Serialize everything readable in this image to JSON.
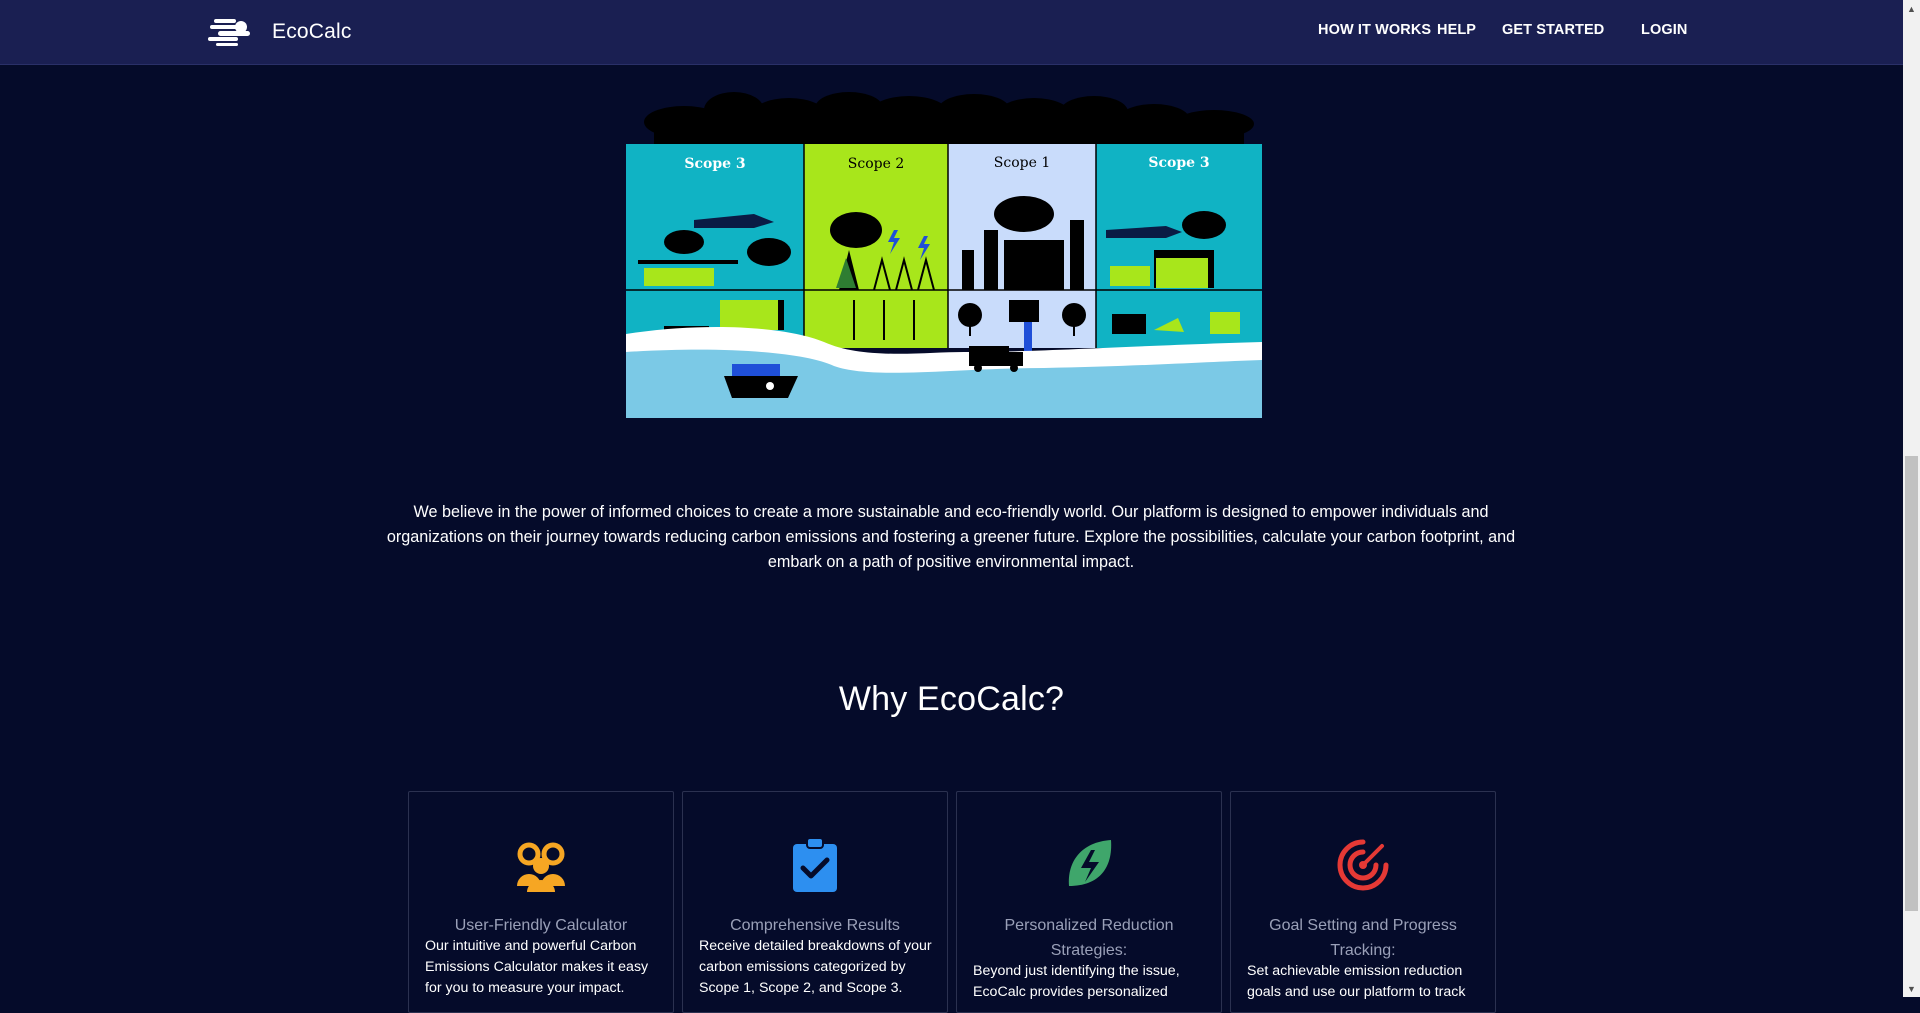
{
  "nav": {
    "brand": "EcoCalc",
    "links": [
      "HOW IT WORKS",
      "HELP",
      "GET STARTED",
      "LOGIN"
    ]
  },
  "hero": {
    "scopes": [
      "Scope 3",
      "Scope 2",
      "Scope 1",
      "Scope 3"
    ]
  },
  "intro": "We believe in the power of informed choices to create a more sustainable and eco-friendly world. Our platform is designed to empower individuals and organizations on their journey towards reducing carbon emissions and fostering a greener future. Explore the possibilities, calculate your carbon footprint, and embark on a path of positive environmental impact.",
  "why": {
    "title": "Why EcoCalc?",
    "cards": [
      {
        "title": "User-Friendly Calculator",
        "text": "Our intuitive and powerful Carbon Emissions Calculator makes it easy for you to measure your impact.",
        "icon": "users-icon",
        "color": "#f6a623"
      },
      {
        "title": "Comprehensive Results",
        "text": "Receive detailed breakdowns of your carbon emissions categorized by Scope 1, Scope 2, and Scope 3.",
        "icon": "clipboard-check-icon",
        "color": "#2d8ff0"
      },
      {
        "title": "Personalized Reduction Strategies:",
        "text": "Beyond just identifying the issue, EcoCalc provides personalized",
        "icon": "leaf-bolt-icon",
        "color": "#3fa66b"
      },
      {
        "title": "Goal Setting and Progress Tracking:",
        "text": "Set achievable emission reduction goals and use our platform to track",
        "icon": "target-icon",
        "color": "#e53935"
      }
    ]
  }
}
